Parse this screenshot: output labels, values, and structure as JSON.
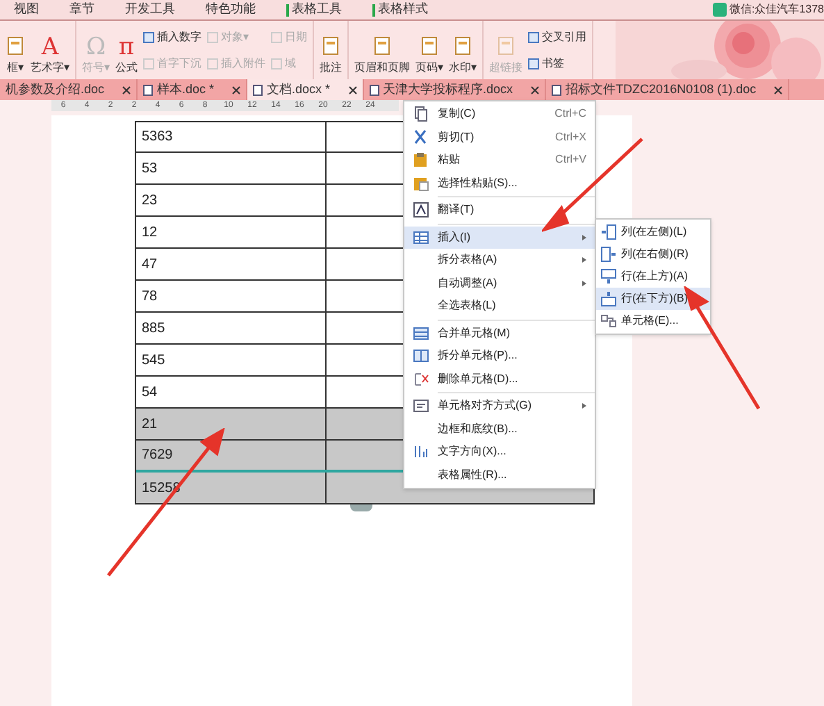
{
  "menu_bar": {
    "items": [
      {
        "label": "视图",
        "contextual": false
      },
      {
        "label": "章节",
        "contextual": false
      },
      {
        "label": "开发工具",
        "contextual": false
      },
      {
        "label": "特色功能",
        "contextual": false
      },
      {
        "label": "表格工具",
        "contextual": true
      },
      {
        "label": "表格样式",
        "contextual": true
      }
    ],
    "user": "微信:众佳汽车1378"
  },
  "ribbon": {
    "groups": [
      {
        "items": [
          {
            "kind": "large",
            "label": "框▾",
            "disabled": false
          },
          {
            "kind": "large",
            "glyph": "A",
            "label": "艺术字▾",
            "disabled": false
          }
        ]
      },
      {
        "items": [
          {
            "kind": "large",
            "glyph": "Ω",
            "label": "符号▾",
            "disabled": true
          },
          {
            "kind": "large",
            "glyph": "π",
            "label": "公式",
            "disabled": false
          },
          {
            "kind": "stack",
            "items": [
              {
                "label": "插入数字",
                "disabled": false
              },
              {
                "label": "首字下沉",
                "disabled": true
              }
            ]
          },
          {
            "kind": "stack",
            "items": [
              {
                "label": "对象▾",
                "disabled": true
              },
              {
                "label": "插入附件",
                "disabled": true
              }
            ]
          },
          {
            "kind": "stack",
            "items": [
              {
                "label": "日期",
                "disabled": true
              },
              {
                "label": "域",
                "disabled": true
              }
            ]
          }
        ]
      },
      {
        "items": [
          {
            "kind": "large",
            "label": "批注",
            "disabled": false
          }
        ]
      },
      {
        "items": [
          {
            "kind": "large",
            "label": "页眉和页脚",
            "disabled": false
          },
          {
            "kind": "large",
            "label": "页码▾",
            "disabled": false
          },
          {
            "kind": "large",
            "label": "水印▾",
            "disabled": false
          }
        ]
      },
      {
        "items": [
          {
            "kind": "large",
            "label": "超链接",
            "disabled": true
          },
          {
            "kind": "stack",
            "items": [
              {
                "label": "交叉引用",
                "disabled": false
              },
              {
                "label": "书签",
                "disabled": false
              }
            ]
          }
        ]
      }
    ]
  },
  "tabs": [
    {
      "label": "机参数及介绍.doc",
      "selected": false
    },
    {
      "label": "样本.doc *",
      "selected": false
    },
    {
      "label": "文档.docx *",
      "selected": true
    },
    {
      "label": "天津大学投标程序.docx",
      "selected": false
    },
    {
      "label": "招标文件TDZC2016N0108 (1).doc",
      "selected": false
    }
  ],
  "ruler": [
    "6",
    "4",
    "2",
    "2",
    "4",
    "6",
    "8",
    "10",
    "12",
    "14",
    "16",
    "20",
    "22",
    "24"
  ],
  "table": {
    "rows": [
      {
        "cell": "5363",
        "selected": false,
        "insert_line_after": false
      },
      {
        "cell": "53",
        "selected": false,
        "insert_line_after": false
      },
      {
        "cell": "23",
        "selected": false,
        "insert_line_after": false
      },
      {
        "cell": "12",
        "selected": false,
        "insert_line_after": false
      },
      {
        "cell": "47",
        "selected": false,
        "insert_line_after": false
      },
      {
        "cell": "78",
        "selected": false,
        "insert_line_after": false
      },
      {
        "cell": "885",
        "selected": false,
        "insert_line_after": false
      },
      {
        "cell": "545",
        "selected": false,
        "insert_line_after": false
      },
      {
        "cell": "54",
        "selected": false,
        "insert_line_after": false
      },
      {
        "cell": "21",
        "selected": true,
        "insert_line_after": false
      },
      {
        "cell": "7629",
        "selected": true,
        "insert_line_after": true
      },
      {
        "cell": "15258",
        "selected": true,
        "insert_line_after": false
      }
    ]
  },
  "context_menu": {
    "groups": [
      [
        {
          "label": "复制(C)",
          "shortcut": "Ctrl+C",
          "submenu": false,
          "selected": false
        },
        {
          "label": "剪切(T)",
          "shortcut": "Ctrl+X",
          "submenu": false,
          "selected": false
        },
        {
          "label": "粘贴",
          "shortcut": "Ctrl+V",
          "submenu": false,
          "selected": false
        },
        {
          "label": "选择性粘贴(S)...",
          "submenu": false,
          "selected": false
        }
      ],
      [
        {
          "label": "翻译(T)",
          "submenu": false,
          "selected": false
        }
      ],
      [
        {
          "label": "插入(I)",
          "submenu": true,
          "selected": true
        },
        {
          "label": "拆分表格(A)",
          "submenu": true,
          "selected": false
        },
        {
          "label": "自动调整(A)",
          "submenu": true,
          "selected": false
        },
        {
          "label": "全选表格(L)",
          "submenu": false,
          "selected": false
        }
      ],
      [
        {
          "label": "合并单元格(M)",
          "submenu": false,
          "selected": false
        },
        {
          "label": "拆分单元格(P)...",
          "submenu": false,
          "selected": false
        },
        {
          "label": "删除单元格(D)...",
          "submenu": false,
          "selected": false
        }
      ],
      [
        {
          "label": "单元格对齐方式(G)",
          "submenu": true,
          "selected": false
        },
        {
          "label": "边框和底纹(B)...",
          "submenu": false,
          "selected": false
        },
        {
          "label": "文字方向(X)...",
          "submenu": false,
          "selected": false
        },
        {
          "label": "表格属性(R)...",
          "submenu": false,
          "selected": false
        }
      ]
    ]
  },
  "submenu": {
    "items": [
      {
        "label": "列(在左侧)(L)",
        "selected": false
      },
      {
        "label": "列(在右侧)(R)",
        "selected": false
      },
      {
        "label": "行(在上方)(A)",
        "selected": false
      },
      {
        "label": "行(在下方)(B)",
        "selected": true
      },
      {
        "label": "单元格(E)...",
        "selected": false
      }
    ]
  }
}
